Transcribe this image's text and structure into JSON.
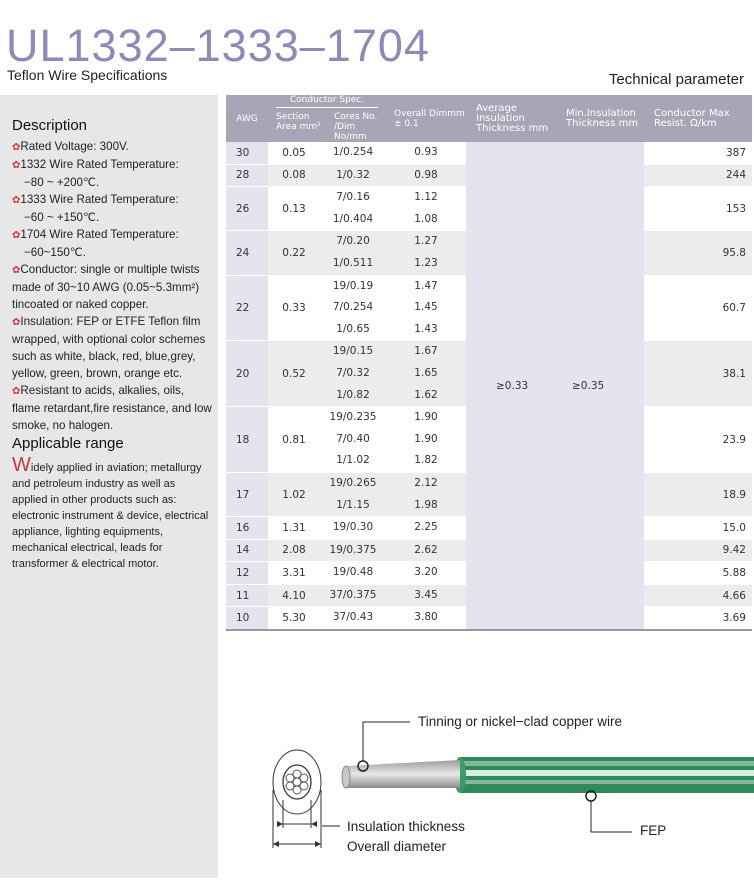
{
  "header": {
    "title": "UL1332–1333–1704",
    "subtitle": "Teflon Wire Specifications",
    "section_label": "Technical parameter"
  },
  "sidebar": {
    "description_heading": "Description",
    "items": [
      "Rated Voltage: 300V.",
      "1332 Wire Rated Temperature:",
      "−80 ~ +200℃.",
      "1333 Wire Rated Temperature:",
      "−60 ~ +150℃.",
      "1704 Wire Rated Temperature:",
      "−60~150℃.",
      "Conductor: single or multiple twists made of 30~10 AWG (0.05~5.3mm²) tincoated or naked copper.",
      "Insulation: FEP or ETFE Teflon film wrapped, with optional color schemes such as white, black, red, blue,grey, yellow, green, brown, orange etc.",
      "Resistant to acids, alkalies, oils, flame retardant,fire resistance, and low smoke, no halogen."
    ],
    "range_heading": "Applicable range",
    "range_dropcap": "W",
    "range_text": "idely applied in aviation; metallurgy and petroleum industry as well as applied in other products such as: electronic instrument & device, electrical appliance, lighting equipments, mechanical electrical, leads for transformer & electrical motor."
  },
  "table": {
    "headers": {
      "awg": "AWG",
      "conductor_spec": "Conductor Spec.",
      "section_area": "Section Area mm²",
      "cores": "Cores No. /Dim No/mm",
      "overall": "Overall Dimmm ± 0.1",
      "avg_ins": "Average Insulation Thickness mm",
      "min_ins": "Min.Insulation Thickness mm",
      "resist": "Conductor Max Resist. Ω/km"
    },
    "avg_insulation": "≥0.33",
    "min_insulation": "≥0.35",
    "rows": [
      {
        "awg": "30",
        "area": "0.05",
        "cores": [
          "1/0.254"
        ],
        "overall": [
          "0.93"
        ],
        "resist": "387"
      },
      {
        "awg": "28",
        "area": "0.08",
        "cores": [
          "1/0.32"
        ],
        "overall": [
          "0.98"
        ],
        "resist": "244"
      },
      {
        "awg": "26",
        "area": "0.13",
        "cores": [
          "7/0.16",
          "1/0.404"
        ],
        "overall": [
          "1.12",
          "1.08"
        ],
        "resist": "153"
      },
      {
        "awg": "24",
        "area": "0.22",
        "cores": [
          "7/0.20",
          "1/0.511"
        ],
        "overall": [
          "1.27",
          "1.23"
        ],
        "resist": "95.8"
      },
      {
        "awg": "22",
        "area": "0.33",
        "cores": [
          "19/0.19",
          "7/0.254",
          "1/0.65"
        ],
        "overall": [
          "1.47",
          "1.45",
          "1.43"
        ],
        "resist": "60.7"
      },
      {
        "awg": "20",
        "area": "0.52",
        "cores": [
          "19/0.15",
          "7/0.32",
          "1/0.82"
        ],
        "overall": [
          "1.67",
          "1.65",
          "1.62"
        ],
        "resist": "38.1"
      },
      {
        "awg": "18",
        "area": "0.81",
        "cores": [
          "19/0.235",
          "7/0.40",
          "1/1.02"
        ],
        "overall": [
          "1.90",
          "1.90",
          "1.82"
        ],
        "resist": "23.9"
      },
      {
        "awg": "17",
        "area": "1.02",
        "cores": [
          "19/0.265",
          "1/1.15"
        ],
        "overall": [
          "2.12",
          "1.98"
        ],
        "resist": "18.9"
      },
      {
        "awg": "16",
        "area": "1.31",
        "cores": [
          "19/0.30"
        ],
        "overall": [
          "2.25"
        ],
        "resist": "15.0"
      },
      {
        "awg": "14",
        "area": "2.08",
        "cores": [
          "19/0.375"
        ],
        "overall": [
          "2.62"
        ],
        "resist": "9.42"
      },
      {
        "awg": "12",
        "area": "3.31",
        "cores": [
          "19/0.48"
        ],
        "overall": [
          "3.20"
        ],
        "resist": "5.88"
      },
      {
        "awg": "11",
        "area": "4.10",
        "cores": [
          "37/0.375"
        ],
        "overall": [
          "3.45"
        ],
        "resist": "4.66"
      },
      {
        "awg": "10",
        "area": "5.30",
        "cores": [
          "37/0.43"
        ],
        "overall": [
          "3.80"
        ],
        "resist": "3.69"
      }
    ]
  },
  "diagram": {
    "conductor_label": "Tinning or nickel−clad copper wire",
    "insulation_label": "Insulation thickness",
    "diameter_label": "Overall diameter",
    "fep_label": "FEP"
  },
  "colors": {
    "title": "#8f88b9",
    "header_bg": "#a8a6b6",
    "insulation_col": "#e4e4ee",
    "bullet": "#dd3333",
    "wire_green": "#2e8a5a"
  }
}
